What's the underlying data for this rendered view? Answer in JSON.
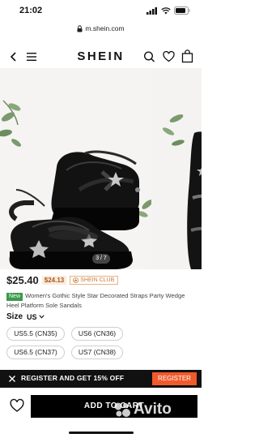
{
  "status_bar": {
    "time": "21:02"
  },
  "browser": {
    "url": "m.shein.com"
  },
  "header": {
    "brand": "SHEIN"
  },
  "gallery": {
    "counter": "3 / 7"
  },
  "product": {
    "price": "$25.40",
    "club_price": "$24.13",
    "club_badge": "SHEIN CLUB",
    "new_badge": "New",
    "title": "Women's Gothic Style Star Decorated Straps Party Wedge Heel Platform Sole Sandals"
  },
  "size": {
    "label": "Size",
    "region": "US",
    "options": [
      "US5.5 (CN35)",
      "US6 (CN36)",
      "US6.5 (CN37)",
      "US7 (CN38)"
    ]
  },
  "promo": {
    "text": "REGISTER AND GET 15% OFF",
    "button": "REGISTER"
  },
  "cart": {
    "button": "ADD TO CART"
  },
  "watermark": {
    "text": "Avito"
  },
  "colors": {
    "accent": "#f15a2b",
    "new_green": "#3a9a4b",
    "club": "#c47b3d"
  }
}
